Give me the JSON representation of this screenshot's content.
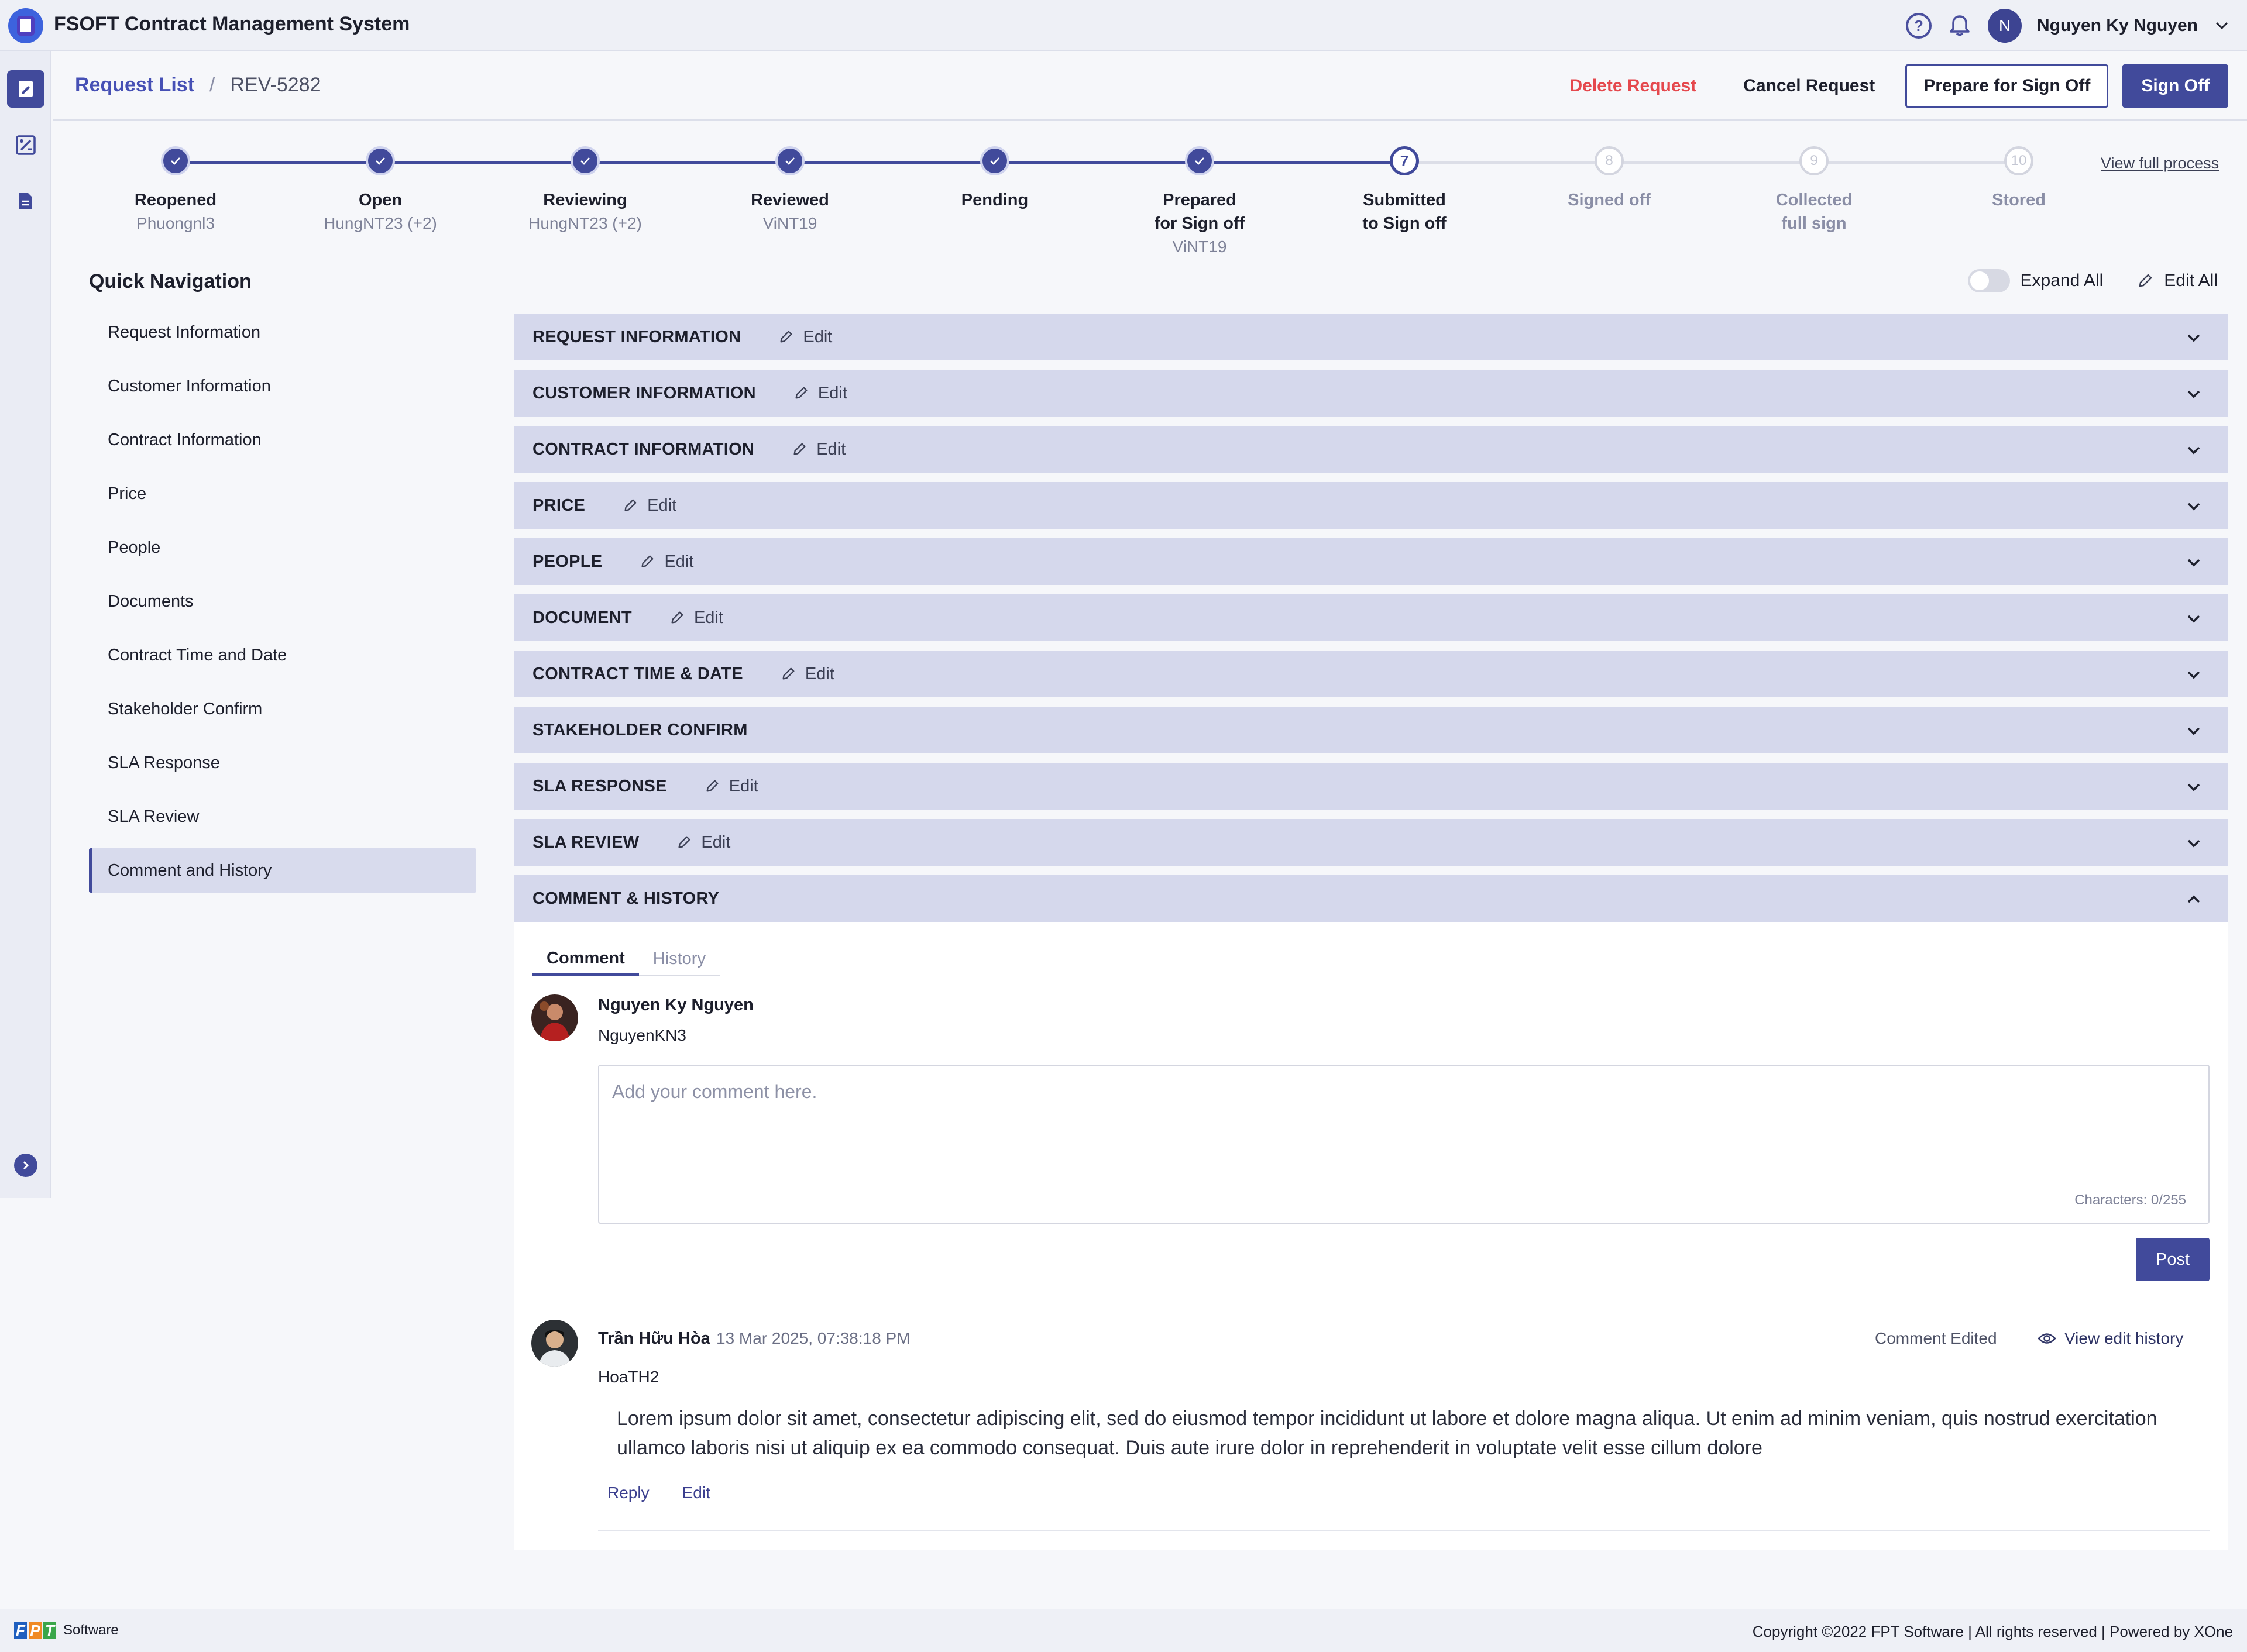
{
  "app": {
    "title": "FSOFT Contract Management System"
  },
  "header": {
    "user_name": "Nguyen Ky Nguyen",
    "avatar_initial": "N",
    "help_glyph": "?"
  },
  "breadcrumb": {
    "parent": "Request List",
    "separator": "/",
    "current": "REV-5282"
  },
  "actions": {
    "delete": "Delete Request",
    "cancel": "Cancel Request",
    "prepare": "Prepare for Sign Off",
    "signoff": "Sign Off"
  },
  "stepper": {
    "view_full": "View full process",
    "steps": [
      {
        "label1": "Reopened",
        "label2": "",
        "sub": "Phuongnl3",
        "state": "done",
        "num": ""
      },
      {
        "label1": "Open",
        "label2": "",
        "sub": "HungNT23 (+2)",
        "state": "done",
        "num": ""
      },
      {
        "label1": "Reviewing",
        "label2": "",
        "sub": "HungNT23 (+2)",
        "state": "done",
        "num": ""
      },
      {
        "label1": "Reviewed",
        "label2": "",
        "sub": "ViNT19",
        "state": "done",
        "num": ""
      },
      {
        "label1": "Pending",
        "label2": "",
        "sub": "",
        "state": "done",
        "num": ""
      },
      {
        "label1": "Prepared",
        "label2": "for Sign off",
        "sub": "ViNT19",
        "state": "done",
        "num": ""
      },
      {
        "label1": "Submitted",
        "label2": "to Sign off",
        "sub": "",
        "state": "current",
        "num": "7"
      },
      {
        "label1": "Signed off",
        "label2": "",
        "sub": "",
        "state": "todo",
        "num": "8"
      },
      {
        "label1": "Collected",
        "label2": "full sign",
        "sub": "",
        "state": "todo",
        "num": "9"
      },
      {
        "label1": "Stored",
        "label2": "",
        "sub": "",
        "state": "todo",
        "num": "10"
      }
    ]
  },
  "quick_nav": {
    "title": "Quick Navigation",
    "items": [
      "Request Information",
      "Customer Information",
      "Contract Information",
      "Price",
      "People",
      "Documents",
      "Contract Time and Date",
      "Stakeholder Confirm",
      "SLA Response",
      "SLA Review",
      "Comment and History"
    ],
    "active_index": 10
  },
  "controls": {
    "expand_all": "Expand All",
    "edit_all": "Edit All"
  },
  "sections": [
    {
      "title": "REQUEST INFORMATION",
      "edit": "Edit"
    },
    {
      "title": "CUSTOMER INFORMATION",
      "edit": "Edit"
    },
    {
      "title": "CONTRACT INFORMATION",
      "edit": "Edit"
    },
    {
      "title": "PRICE",
      "edit": "Edit"
    },
    {
      "title": "PEOPLE",
      "edit": "Edit"
    },
    {
      "title": "DOCUMENT",
      "edit": "Edit"
    },
    {
      "title": "CONTRACT TIME & DATE",
      "edit": "Edit"
    },
    {
      "title": "STAKEHOLDER CONFIRM",
      "edit": ""
    },
    {
      "title": "SLA RESPONSE",
      "edit": "Edit"
    },
    {
      "title": "SLA REVIEW",
      "edit": "Edit"
    },
    {
      "title": "COMMENT & HISTORY",
      "edit": ""
    }
  ],
  "comment": {
    "tabs": {
      "comment": "Comment",
      "history": "History"
    },
    "composer": {
      "name": "Nguyen Ky Nguyen",
      "id": "NguyenKN3",
      "placeholder": "Add your comment here.",
      "counter": "Characters: 0/255",
      "post": "Post"
    },
    "entry": {
      "name": "Trần Hữu Hòa",
      "time": "13 Mar 2025, 07:38:18 PM",
      "id": "HoaTH2",
      "edited": "Comment Edited",
      "view_history": "View edit history",
      "text": "Lorem ipsum dolor sit amet, consectetur adipiscing elit, sed do eiusmod tempor incididunt ut labore et dolore magna aliqua. Ut enim ad minim veniam, quis nostrud exercitation ullamco laboris nisi ut aliquip ex ea commodo consequat. Duis aute irure dolor in reprehenderit in voluptate velit esse cillum dolore",
      "reply": "Reply",
      "edit": "Edit"
    }
  },
  "footer": {
    "brand_letters": [
      "F",
      "P",
      "T"
    ],
    "brand_word": "Software",
    "copyright": "Copyright ©2022 FPT Software | All rights reserved | Powered by XOne"
  },
  "colors": {
    "primary": "#414a9b",
    "danger": "#e5484d",
    "section_bg": "#d5d8ec",
    "fpt_blue": "#1f5fbf",
    "fpt_orange": "#f08a24",
    "fpt_green": "#3aa64a"
  },
  "icons": {
    "logo": "app-logo-icon",
    "help": "help-circle-icon",
    "bell": "bell-icon",
    "chevron": "chevron-down-icon",
    "pencil": "pencil-icon",
    "eye": "eye-icon",
    "check": "check-icon"
  }
}
